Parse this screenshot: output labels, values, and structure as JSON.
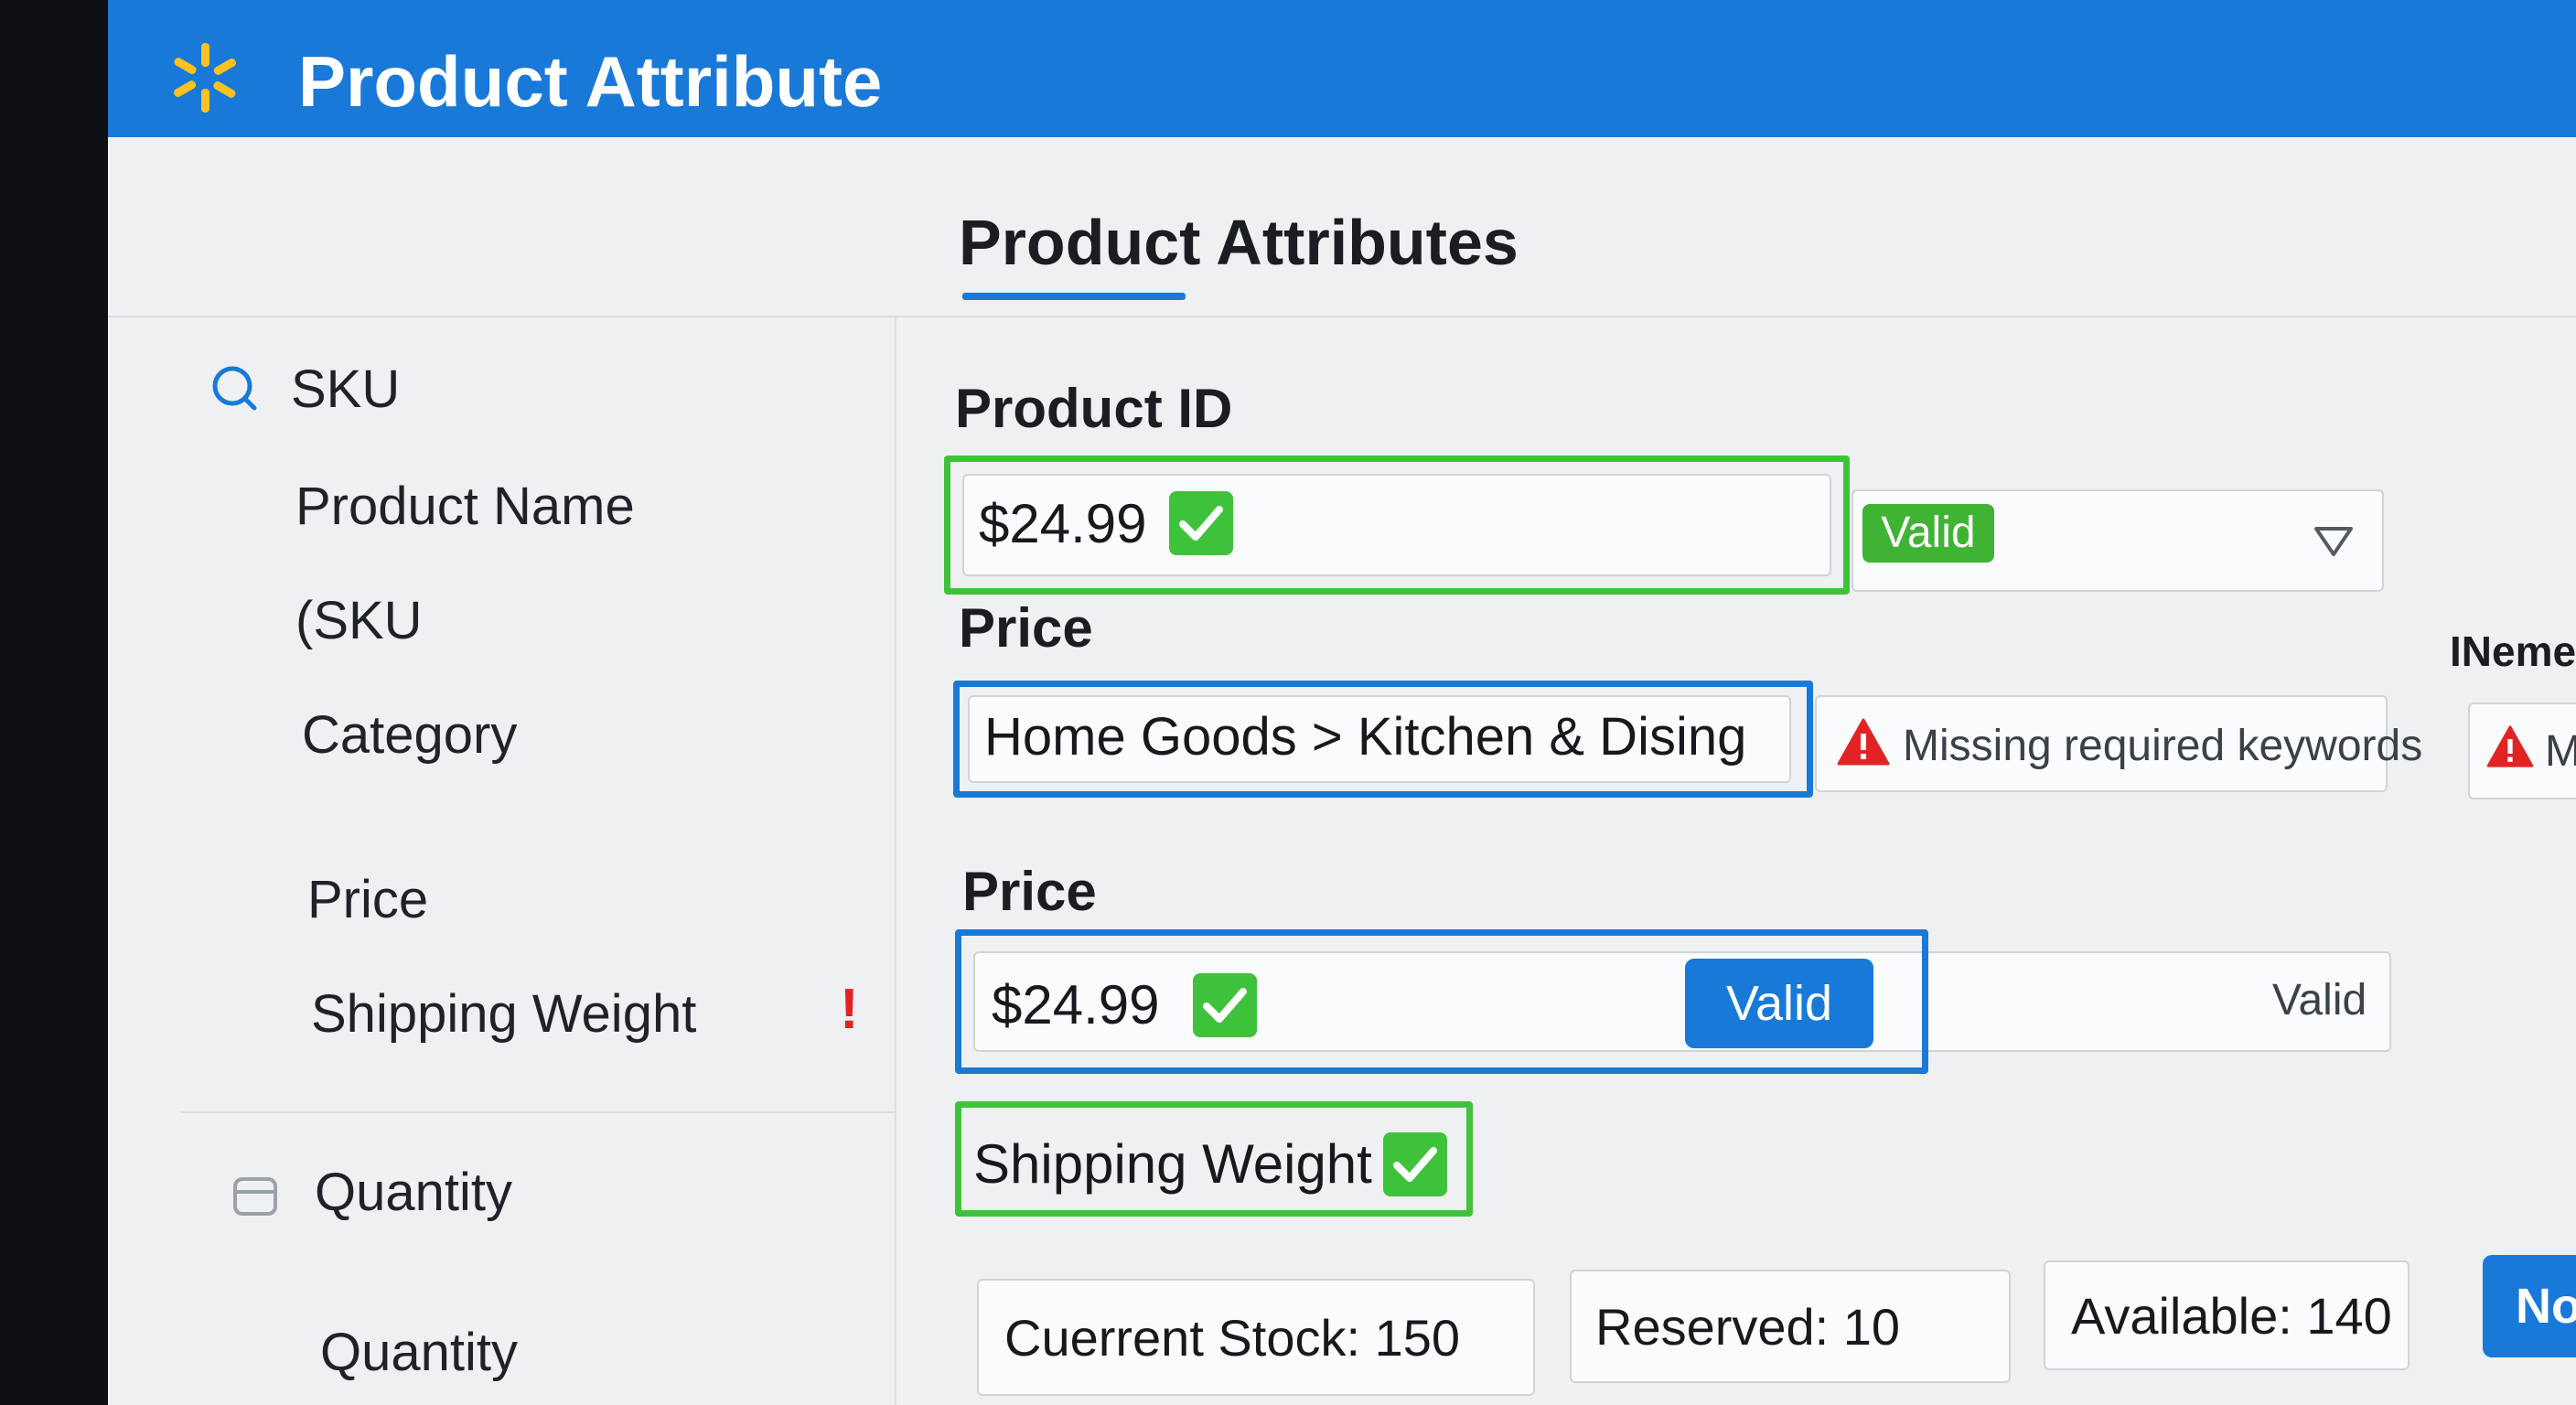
{
  "header": {
    "title": "Product Attribute",
    "logo": "spark-logo-icon"
  },
  "section": {
    "title": "Product Attributes"
  },
  "sidebar": {
    "items": [
      {
        "label": "SKU",
        "icon": "search-icon"
      },
      {
        "label": "Product Name"
      },
      {
        "label": "(SKU"
      },
      {
        "label": "Category"
      },
      {
        "label": "Price"
      },
      {
        "label": "Shipping Weight",
        "error_mark": "!"
      },
      {
        "label": "Quantity",
        "icon": "box-icon"
      },
      {
        "label": "Quantity"
      }
    ]
  },
  "form": {
    "product_id": {
      "label": "Product ID",
      "value": "$24.99",
      "status": "Valid"
    },
    "category_field": {
      "label": "Price",
      "value": "Home Goods > Kitchen & Dising",
      "warning": "Missing required keywords"
    },
    "right_edge": {
      "label": "INeme",
      "warning": "M"
    },
    "price": {
      "label": "Price",
      "value": "$24.99",
      "button": "Valid",
      "status": "Valid"
    },
    "shipping_weight": {
      "label": "Shipping Weight"
    },
    "stock": {
      "current": "Cuerrent Stock: 150",
      "reserved": "Reserved: 10",
      "available": "Available: 140",
      "button": "No"
    }
  },
  "colors": {
    "accent": "#1979d8",
    "success": "#3fc23b",
    "error": "#e02424"
  }
}
